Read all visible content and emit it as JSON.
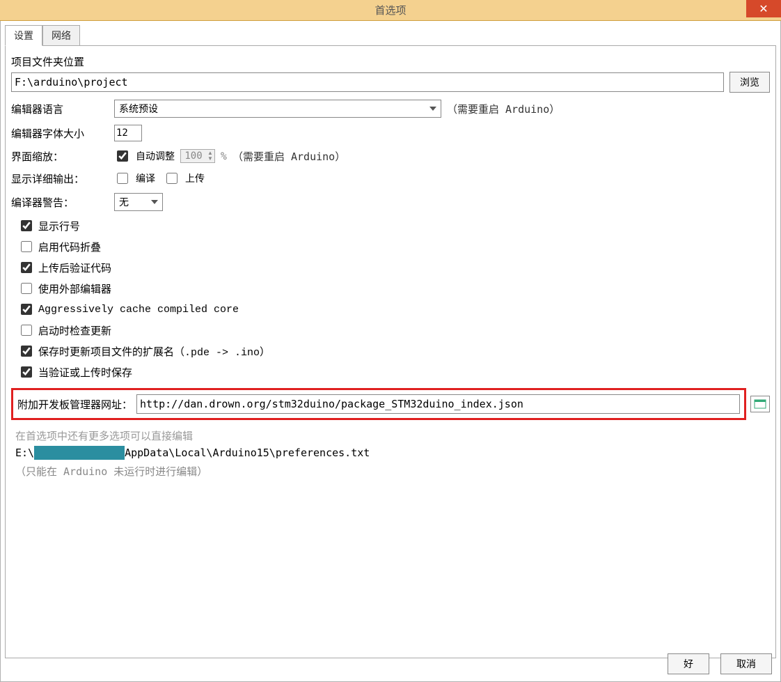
{
  "window": {
    "title": "首选项",
    "close_symbol": "✕"
  },
  "tabs": {
    "settings": "设置",
    "network": "网络"
  },
  "sketchbook": {
    "label": "项目文件夹位置",
    "value": "F:\\arduino\\project",
    "browse": "浏览"
  },
  "editor_lang": {
    "label": "编辑器语言",
    "value": "系统预设",
    "hint": "（需要重启 Arduino）"
  },
  "font_size": {
    "label": "编辑器字体大小",
    "value": "12"
  },
  "ui_scale": {
    "label": "界面缩放：",
    "auto_label": "自动调整",
    "auto_checked": true,
    "value": "100",
    "pct": "%",
    "hint": "（需要重启 Arduino）"
  },
  "verbose": {
    "label": "显示详细输出：",
    "compile": "编译",
    "upload": "上传",
    "compile_checked": false,
    "upload_checked": false
  },
  "compiler_warn": {
    "label": "编译器警告：",
    "value": "无"
  },
  "checks": [
    {
      "label": "显示行号",
      "checked": true
    },
    {
      "label": "启用代码折叠",
      "checked": false
    },
    {
      "label": "上传后验证代码",
      "checked": true
    },
    {
      "label": "使用外部编辑器",
      "checked": false
    },
    {
      "label": "Aggressively cache compiled core",
      "checked": true,
      "mono": true
    },
    {
      "label": "启动时检查更新",
      "checked": false
    },
    {
      "label": "保存时更新项目文件的扩展名（.pde -> .ino）",
      "checked": true
    },
    {
      "label": "当验证或上传时保存",
      "checked": true
    }
  ],
  "boards_url": {
    "label": "附加开发板管理器网址：",
    "value": "http://dan.drown.org/stm32duino/package_STM32duino_index.json"
  },
  "more_prefs": {
    "note": "在首选项中还有更多选项可以直接编辑",
    "path_prefix": "E:\\",
    "path_suffix": "AppData\\Local\\Arduino15\\preferences.txt",
    "note2": "（只能在 Arduino 未运行时进行编辑）"
  },
  "buttons": {
    "ok": "好",
    "cancel": "取消"
  }
}
